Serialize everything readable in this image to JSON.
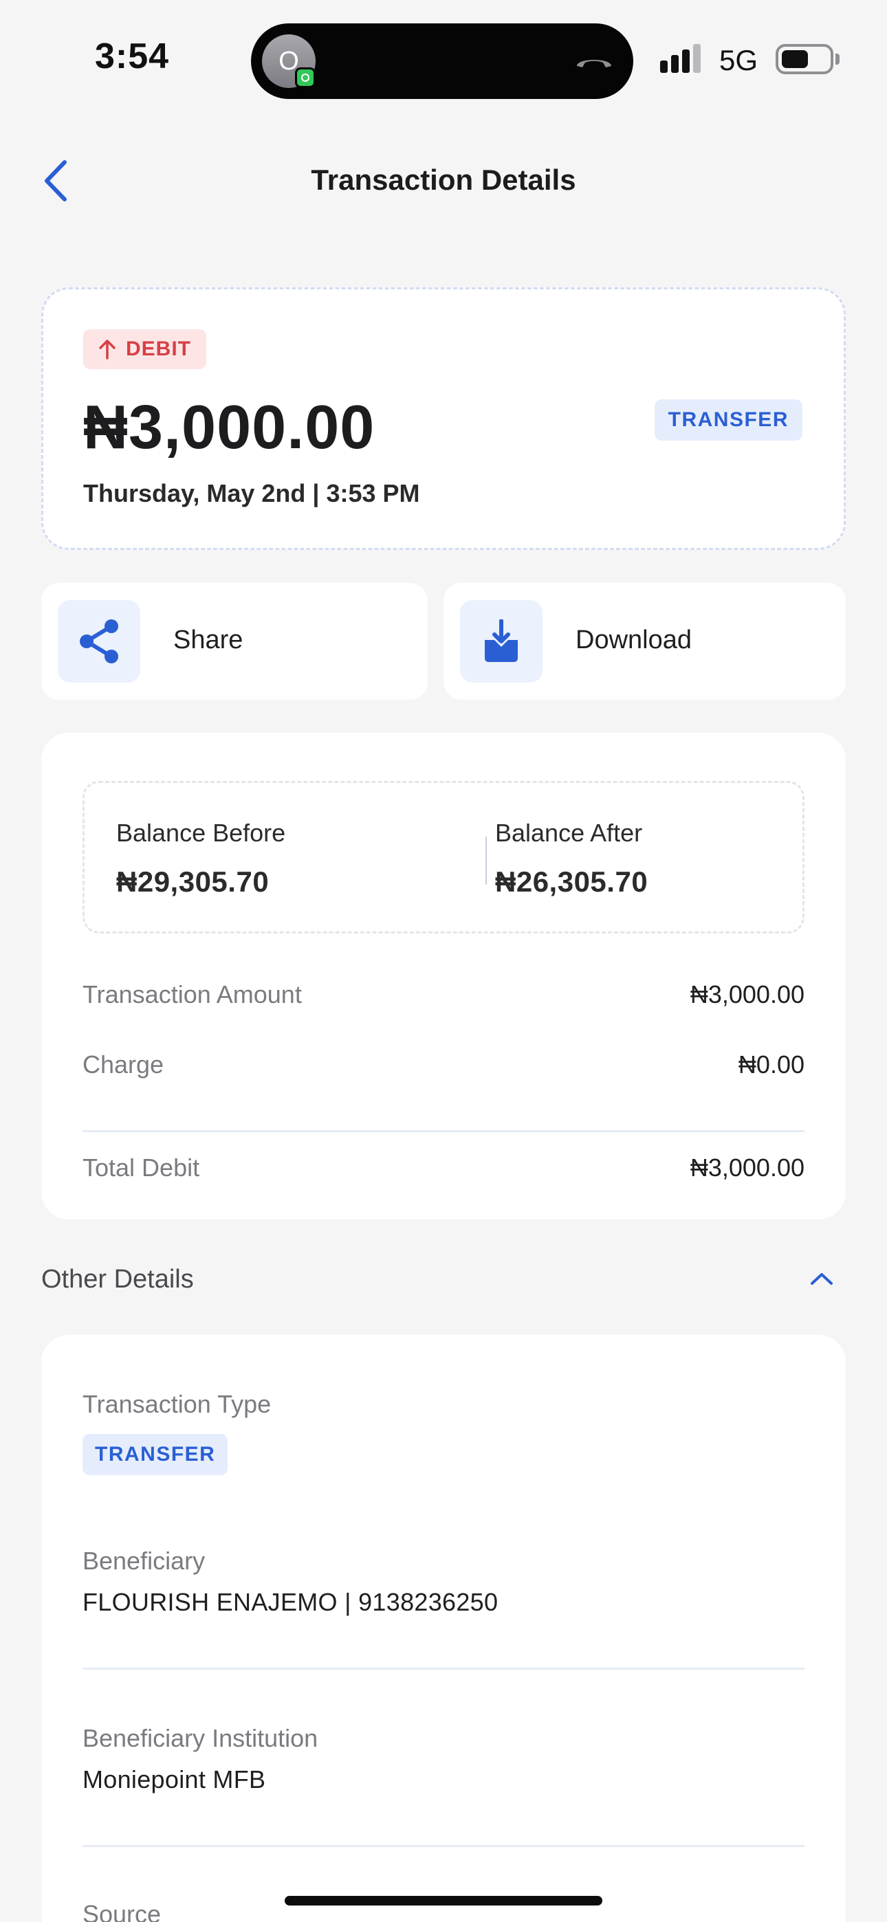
{
  "status_bar": {
    "time": "3:54",
    "island_avatar_letter": "O",
    "network": "5G"
  },
  "header": {
    "title": "Transaction Details"
  },
  "summary": {
    "direction_label": "DEBIT",
    "amount": "₦3,000.00",
    "type_chip": "TRANSFER",
    "datetime": "Thursday, May 2nd | 3:53 PM"
  },
  "actions": {
    "share_label": "Share",
    "download_label": "Download"
  },
  "balances": {
    "before_label": "Balance Before",
    "before_value": "₦29,305.70",
    "after_label": "Balance After",
    "after_value": "₦26,305.70"
  },
  "breakdown": [
    {
      "label": "Transaction Amount",
      "value": "₦3,000.00"
    },
    {
      "label": "Charge",
      "value": "₦0.00"
    },
    {
      "label": "Total Debit",
      "value": "₦3,000.00"
    }
  ],
  "other_details": {
    "title": "Other Details",
    "transaction_type_label": "Transaction Type",
    "transaction_type_value": "TRANSFER",
    "beneficiary_label": "Beneficiary",
    "beneficiary_value": "FLOURISH ENAJEMO | 9138236250",
    "institution_label": "Beneficiary Institution",
    "institution_value": "Moniepoint MFB",
    "source_label": "Source"
  },
  "colors": {
    "accent": "#2a5fd4",
    "debit": "#d64045",
    "background": "#f5f5f6"
  }
}
